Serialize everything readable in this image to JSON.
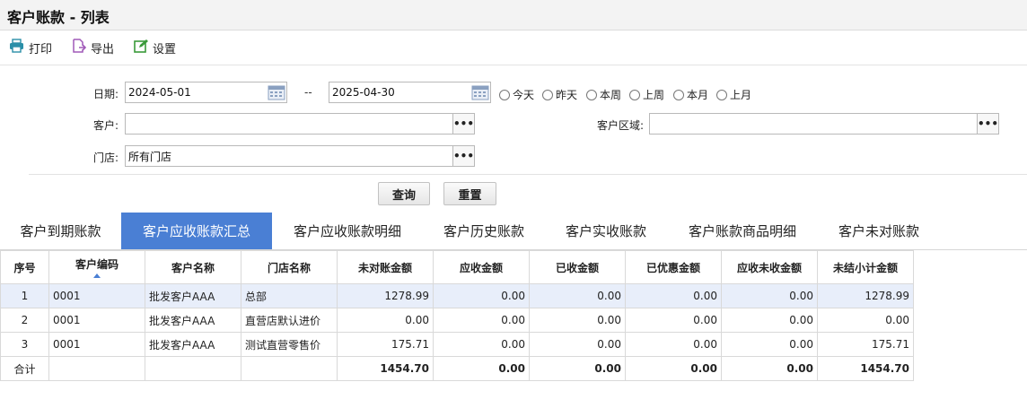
{
  "window": {
    "title": "客户账款 - 列表"
  },
  "toolbar": {
    "print_label": "打印",
    "export_label": "导出",
    "settings_label": "设置"
  },
  "filters": {
    "date_label": "日期:",
    "date_from": "2024-05-01",
    "date_to": "2025-04-30",
    "range_separator": "--",
    "customer_label": "客户:",
    "customer_value": "",
    "region_label": "客户区域:",
    "region_value": "",
    "store_label": "门店:",
    "store_value": "所有门店",
    "browse_label": "•••",
    "quick_ranges": [
      "今天",
      "昨天",
      "本周",
      "上周",
      "本月",
      "上月"
    ]
  },
  "actions": {
    "query_label": "查询",
    "reset_label": "重置"
  },
  "tabs": [
    {
      "label": "客户到期账款",
      "active": false
    },
    {
      "label": "客户应收账款汇总",
      "active": true
    },
    {
      "label": "客户应收账款明细",
      "active": false
    },
    {
      "label": "客户历史账款",
      "active": false
    },
    {
      "label": "客户实收账款",
      "active": false
    },
    {
      "label": "客户账款商品明细",
      "active": false
    },
    {
      "label": "客户未对账款",
      "active": false
    }
  ],
  "table": {
    "columns": [
      "序号",
      "客户编码",
      "客户名称",
      "门店名称",
      "未对账金额",
      "应收金额",
      "已收金额",
      "已优惠金额",
      "应收未收金额",
      "未结小计金额"
    ],
    "sorted_column": "客户编码",
    "rows": [
      [
        "1",
        "0001",
        "批发客户AAA",
        "总部",
        "1278.99",
        "0.00",
        "0.00",
        "0.00",
        "0.00",
        "1278.99"
      ],
      [
        "2",
        "0001",
        "批发客户AAA",
        "直营店默认进价",
        "0.00",
        "0.00",
        "0.00",
        "0.00",
        "0.00",
        "0.00"
      ],
      [
        "3",
        "0001",
        "批发客户AAA",
        "测试直营零售价",
        "175.71",
        "0.00",
        "0.00",
        "0.00",
        "0.00",
        "175.71"
      ]
    ],
    "selected_row": 1,
    "total": [
      "合计",
      "",
      "",
      "",
      "1454.70",
      "0.00",
      "0.00",
      "0.00",
      "0.00",
      "1454.70"
    ]
  },
  "colors": {
    "accent": "#4a7fd4",
    "selected_row": "#e8eefa"
  }
}
